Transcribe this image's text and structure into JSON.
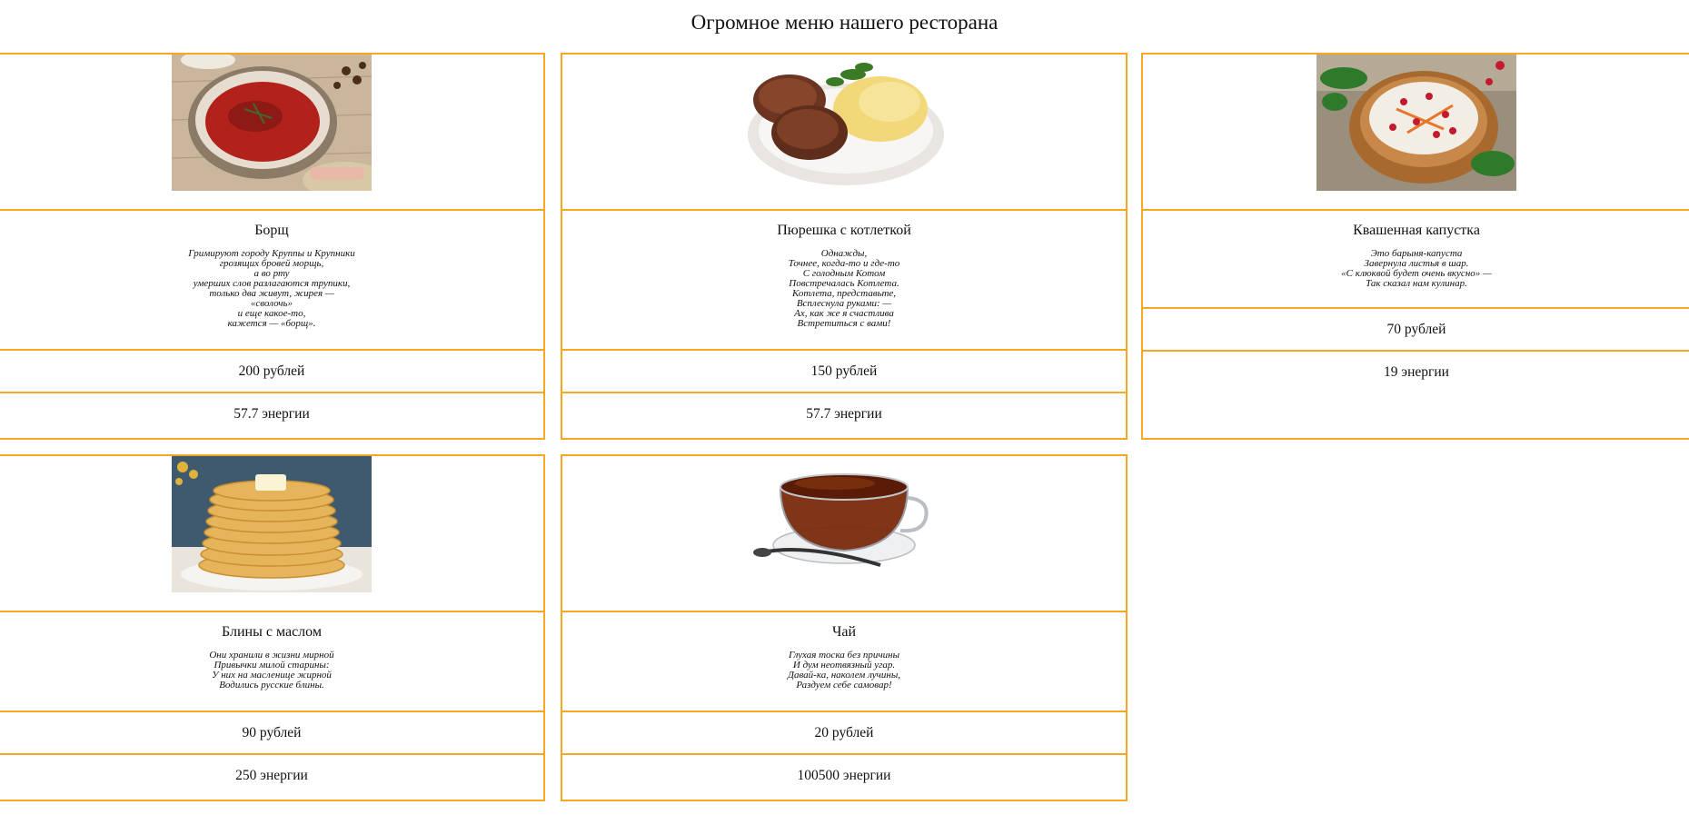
{
  "page": {
    "title": "Огромное меню нашего ресторана"
  },
  "colors": {
    "border": "#f5a623"
  },
  "dishes": [
    {
      "name": "Борщ",
      "image": "borscht-photo",
      "poem": [
        "Гримируют городу Круппы и Крупники",
        "грозящих бровей морщь,",
        "а во рту",
        "умерших слов разлагаются трупики,",
        "только два живут, жирея —",
        "«сволочь»",
        "и еще какое-то,",
        "кажется — «борщ»."
      ],
      "price": "200 рублей",
      "energy": "57.7 энергии"
    },
    {
      "name": "Пюрешка с котлеткой",
      "image": "cutlet-with-mash-photo",
      "poem": [
        "Однажды,",
        "Точнее, когда-то и где-то",
        "С голодным Котом",
        "Повстречалась Котлета.",
        "Котлета, представьте,",
        "Всплеснула руками: —",
        "Ах, как же я счастлива",
        "Встретиться с вами!"
      ],
      "price": "150 рублей",
      "energy": "57.7 энергии"
    },
    {
      "name": "Квашенная капустка",
      "image": "sauerkraut-photo",
      "poem": [
        "Это барыня-капуста",
        "Завернула листья в шар.",
        "«С клюквой будет очень вкусно» —",
        "Так сказал нам кулинар."
      ],
      "price": "70 рублей",
      "energy": "19 энергии"
    },
    {
      "name": "Блины с маслом",
      "image": "pancakes-photo",
      "poem": [
        "Они хранили в жизни мирной",
        "Привычки милой старины:",
        "У них на масленице жирной",
        "Водились русские блины."
      ],
      "price": "90 рублей",
      "energy": "250 энергии"
    },
    {
      "name": "Чай",
      "image": "tea-cup-photo",
      "poem": [
        "Глухая тоска без причины",
        "И дум неотвязный угар.",
        "Давай-ка, наколем лучины,",
        "Раздуем себе самовар!"
      ],
      "price": "20 рублей",
      "energy": "100500 энергии"
    }
  ]
}
